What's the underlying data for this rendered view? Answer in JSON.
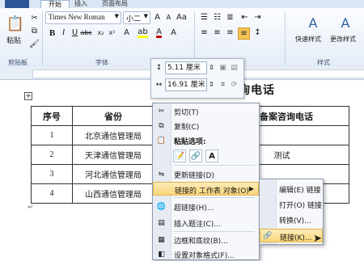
{
  "tabs": [
    {
      "label": "开始"
    },
    {
      "label": "插入"
    },
    {
      "label": "页面布局"
    }
  ],
  "ribbon": {
    "paste_label": "粘贴",
    "clipboard_group": "剪贴板",
    "font_name": "Times New Roman",
    "font_size": "小二",
    "font_group": "字体",
    "quick_styles": "快速样式",
    "change_styles": "更改样式",
    "styles_group": "样式",
    "font_color_hex": "#c00000",
    "highlight_hex": "#ffff00",
    "accent_hex": "#f5c452"
  },
  "mini_toolbar": {
    "width_value": "5.11 厘米",
    "height_value": "16.91 厘米"
  },
  "document": {
    "title": "各省管局备案咨询电话",
    "headers": [
      "序号",
      "省份",
      "",
      "站备案咨询电话"
    ],
    "rows": [
      {
        "no": "1",
        "province": "北京通信管理局",
        "c3": "",
        "phone": ""
      },
      {
        "no": "2",
        "province": "天津通信管理局",
        "c3": "",
        "phone": "测试"
      },
      {
        "no": "3",
        "province": "河北通信管理局",
        "c3": "",
        "phone": ""
      },
      {
        "no": "4",
        "province": "山西通信管理局",
        "c3": "",
        "phone": ""
      }
    ]
  },
  "context_menu": {
    "cut": "剪切(T)",
    "copy": "复制(C)",
    "paste_options": "粘贴选项:",
    "update_link": "更新链接(D)",
    "linked_object": "链接的 工作表 对象(O)",
    "hyperlink": "超链接(H)...",
    "insert_caption": "插入题注(C)...",
    "borders": "边框和底纹(B)...",
    "format_object": "设置对象格式(F)..."
  },
  "submenu": {
    "edit_link": "编辑(E) 链接",
    "open_link": "打开(O) 链接",
    "convert": "转换(V)...",
    "links": "链接(K)..."
  }
}
